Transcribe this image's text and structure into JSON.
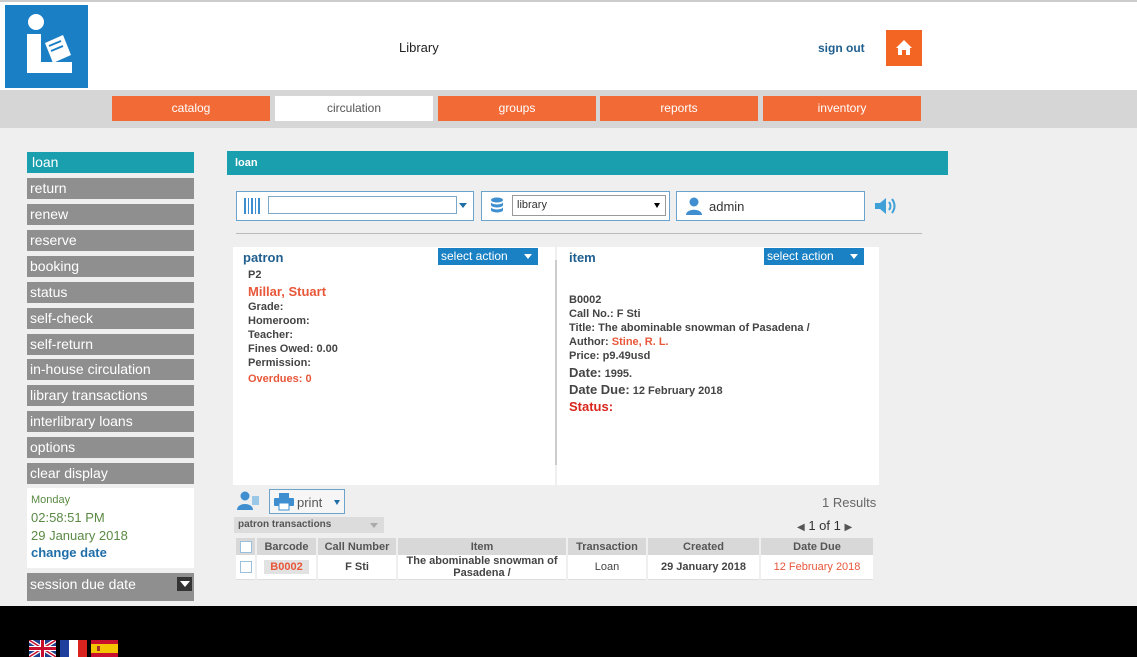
{
  "header": {
    "app_title": "Library",
    "signout_label": "sign out"
  },
  "topnav": {
    "tabs": [
      {
        "label": "catalog"
      },
      {
        "label": "circulation"
      },
      {
        "label": "groups"
      },
      {
        "label": "reports"
      },
      {
        "label": "inventory"
      }
    ],
    "active_tab": "circulation"
  },
  "sidebar": {
    "items": [
      {
        "label": "loan"
      },
      {
        "label": "return"
      },
      {
        "label": "renew"
      },
      {
        "label": "reserve"
      },
      {
        "label": "booking"
      },
      {
        "label": "status"
      },
      {
        "label": "self-check"
      },
      {
        "label": "self-return"
      },
      {
        "label": "in-house circulation"
      },
      {
        "label": "library transactions"
      },
      {
        "label": "interlibrary loans"
      },
      {
        "label": "options"
      },
      {
        "label": "clear display"
      }
    ],
    "day_name": "Monday",
    "time": "02:58:51 PM",
    "date": "29 January 2018",
    "change_date_label": "change date",
    "session_due_label": "session due date"
  },
  "main": {
    "title": "loan",
    "barcode_value": "",
    "library_select": "library",
    "user_name": "admin"
  },
  "patron": {
    "title": "patron",
    "action_label": "select action",
    "id": "P2",
    "name": "Millar, Stuart",
    "grade_label": "Grade:",
    "homeroom_label": "Homeroom:",
    "teacher_label": "Teacher:",
    "fines_label": "Fines Owed:",
    "fines_value": "0.00",
    "permission_label": "Permission:",
    "overdues_label": "Overdues:",
    "overdues_value": "0"
  },
  "item": {
    "title": "item",
    "action_label": "select action",
    "id": "B0002",
    "call_label": "Call No.:",
    "call_value": "F Sti",
    "title_label": "Title:",
    "title_value": "The abominable snowman of Pasadena /",
    "author_label": "Author:",
    "author_value": "Stine, R. L.",
    "price_label": "Price:",
    "price_value": "p9.49usd",
    "date_label": "Date:",
    "date_value": "1995.",
    "due_label": "Date Due:",
    "due_value": "12 February 2018",
    "status_label": "Status:"
  },
  "results": {
    "print_label": "print",
    "count_text": "1 Results",
    "transactions_select": "patron transactions",
    "page_text": "1 of 1",
    "columns": [
      "Barcode",
      "Call Number",
      "Item",
      "Transaction",
      "Created",
      "Date Due"
    ],
    "rows": [
      {
        "barcode": "B0002",
        "call_number": "F Sti",
        "item": "The abominable snowman of Pasadena /",
        "transaction": "Loan",
        "created": "29 January 2018",
        "date_due": "12 February 2018"
      }
    ]
  },
  "icons": {
    "logo": "library-logo-icon",
    "home": "home-icon",
    "barcode": "barcode-icon",
    "database": "database-icon",
    "user": "user-icon",
    "speaker": "speaker-icon",
    "patron": "patron-icon",
    "printer": "printer-icon"
  },
  "colors": {
    "brand_blue": "#1a7fc4",
    "accent_orange": "#f26a36",
    "teal": "#1a9fae",
    "sidebar_gray": "#8f8f8f",
    "link_blue": "#1f5f8f",
    "highlight_red": "#e8573a"
  },
  "languages": [
    "english-flag",
    "french-flag",
    "spanish-flag"
  ]
}
